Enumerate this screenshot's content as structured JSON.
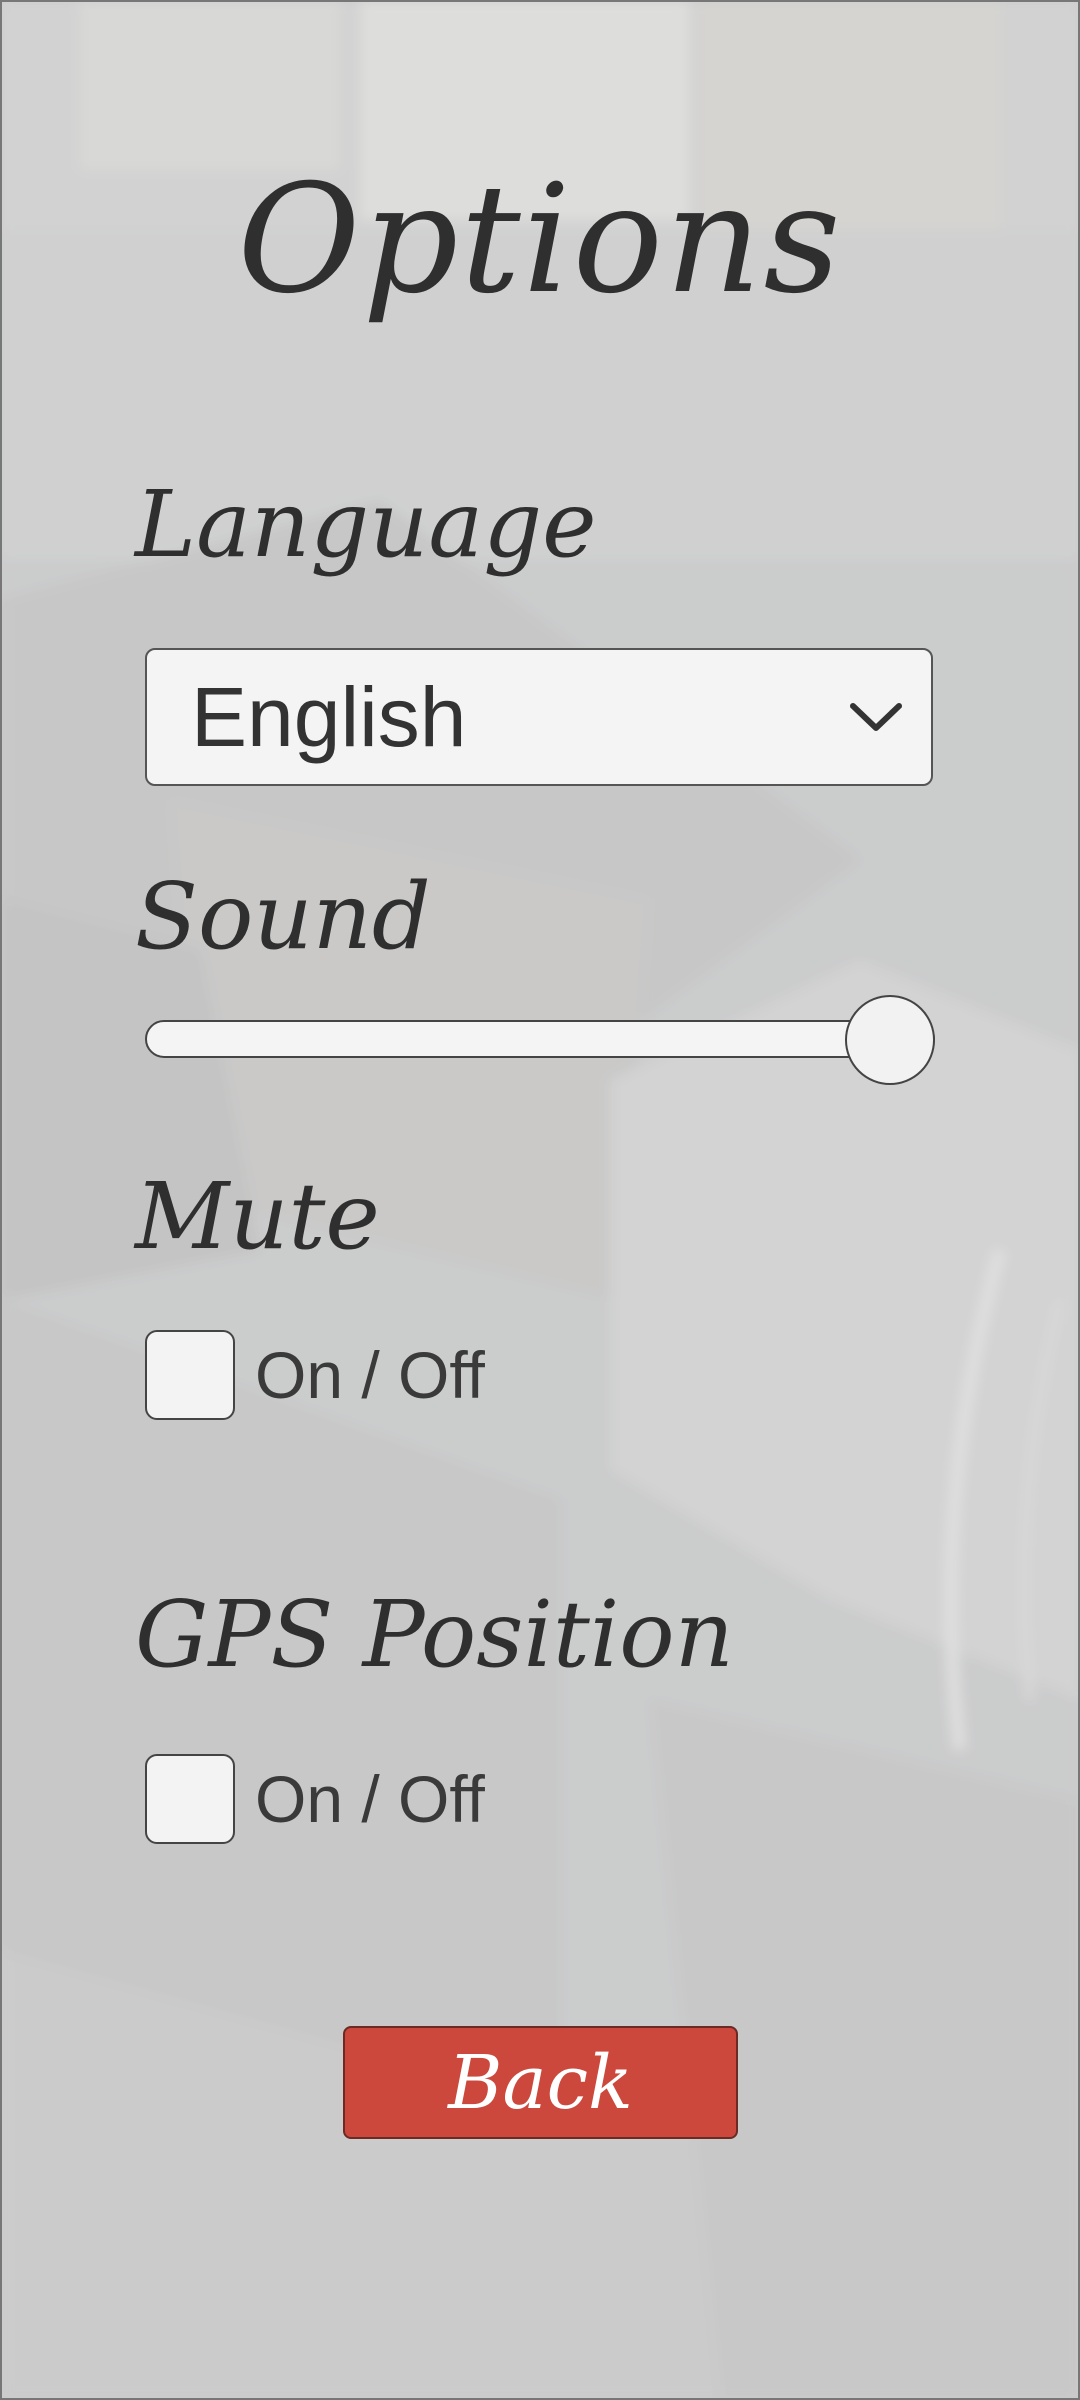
{
  "screen": {
    "title": "Options"
  },
  "language": {
    "label": "Language",
    "selected": "English",
    "dropdown_icon": "chevron-down-icon"
  },
  "sound": {
    "label": "Sound",
    "level_percent": 100
  },
  "mute": {
    "label": "Mute",
    "checkbox_label": "On / Off",
    "checked": false
  },
  "gps": {
    "label": "GPS Position",
    "checkbox_label": "On / Off",
    "checked": false
  },
  "back": {
    "label": "Back",
    "color": "#cd483c"
  }
}
